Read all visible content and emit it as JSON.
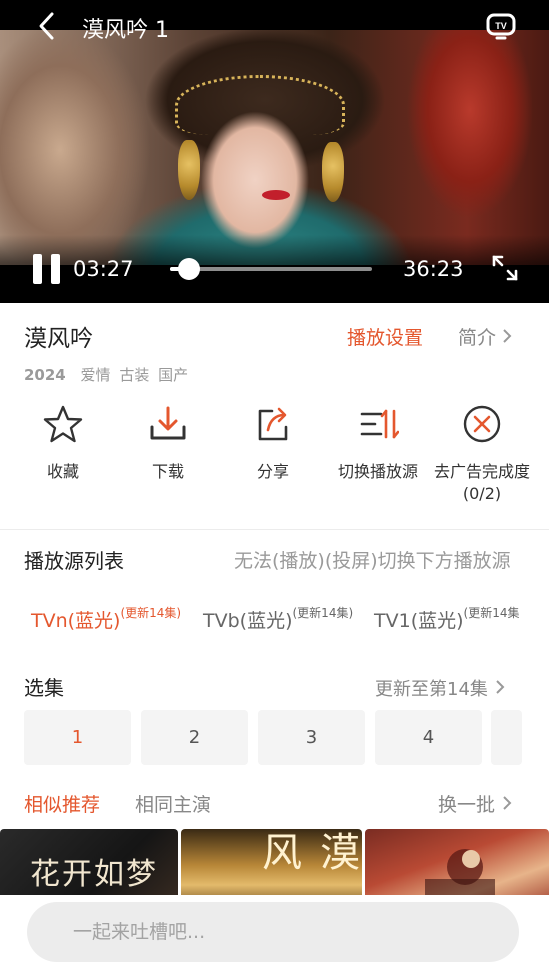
{
  "player": {
    "title": "漠风吟 1",
    "time_current": "03:27",
    "time_total": "36:23",
    "progress_fraction": 0.095
  },
  "info": {
    "title": "漠风吟",
    "play_settings": "播放设置",
    "intro": "简介",
    "year": "2024",
    "tags": [
      "爱情",
      "古装",
      "国产"
    ],
    "actions": [
      {
        "label": "收藏",
        "icon": "star-icon"
      },
      {
        "label": "下载",
        "icon": "download-icon"
      },
      {
        "label": "分享",
        "icon": "share-icon"
      },
      {
        "label": "切换播放源",
        "icon": "switch-source-icon"
      },
      {
        "label": "去广告完成度",
        "sub": "(0/2)",
        "icon": "ad-block-icon"
      }
    ]
  },
  "sources": {
    "title": "播放源列表",
    "hint": "无法(播放)(投屏)切换下方播放源",
    "items": [
      {
        "name": "TVn(蓝光)",
        "badge": "(更新14集)"
      },
      {
        "name": "TVb(蓝光)",
        "badge": "(更新14集)"
      },
      {
        "name": "TV1(蓝光)",
        "badge": "(更新14集"
      }
    ]
  },
  "episodes": {
    "title": "选集",
    "update": "更新至第14集",
    "items": [
      "1",
      "2",
      "3",
      "4"
    ]
  },
  "recs": {
    "tab_similar": "相似推荐",
    "tab_cast": "相同主演",
    "refresh": "换一批",
    "poster_1_text": "花开如梦",
    "poster_2_text": "漠风"
  },
  "comment": {
    "placeholder": "一起来吐槽吧..."
  },
  "colors": {
    "accent": "#e4572e"
  }
}
